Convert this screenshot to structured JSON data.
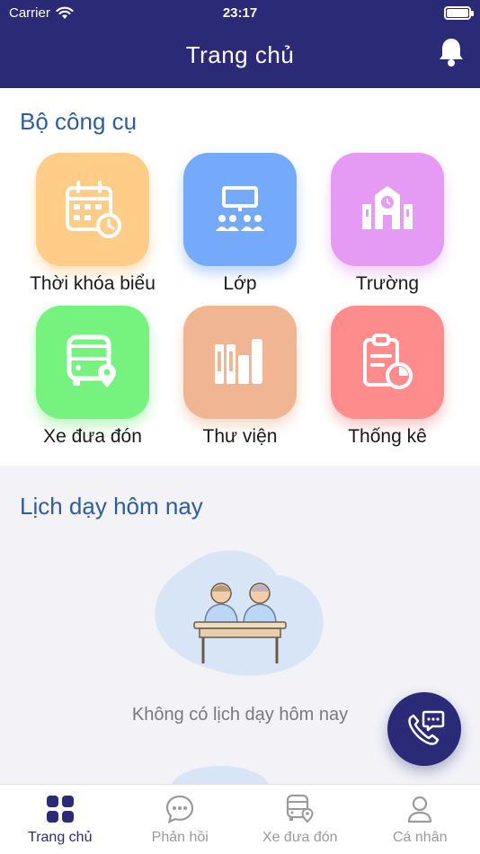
{
  "status_bar": {
    "carrier": "Carrier",
    "time": "23:17"
  },
  "header": {
    "title": "Trang chủ"
  },
  "tools": {
    "title": "Bộ công cụ",
    "items": [
      {
        "label": "Thời khóa biểu",
        "icon": "calendar-icon",
        "color": "#ffcd87"
      },
      {
        "label": "Lớp",
        "icon": "classroom-icon",
        "color": "#74aaf9"
      },
      {
        "label": "Trường",
        "icon": "school-icon",
        "color": "#e59bf3"
      },
      {
        "label": "Xe đưa đón",
        "icon": "bus-icon",
        "color": "#76f37f"
      },
      {
        "label": "Thư viện",
        "icon": "library-icon",
        "color": "#f0b592"
      },
      {
        "label": "Thống kê",
        "icon": "report-icon",
        "color": "#ff8c8c"
      }
    ]
  },
  "schedule": {
    "title": "Lịch dạy hôm nay",
    "empty_text": "Không có lịch dạy hôm nay"
  },
  "tabbar": {
    "items": [
      {
        "label": "Trang chủ",
        "icon": "grid-icon",
        "active": true
      },
      {
        "label": "Phản hồi",
        "icon": "chat-icon",
        "active": false
      },
      {
        "label": "Xe đưa đón",
        "icon": "bus-icon",
        "active": false
      },
      {
        "label": "Cá nhân",
        "icon": "user-icon",
        "active": false
      }
    ]
  },
  "colors": {
    "primary": "#2b2a76",
    "section_title": "#2d5d9f"
  }
}
